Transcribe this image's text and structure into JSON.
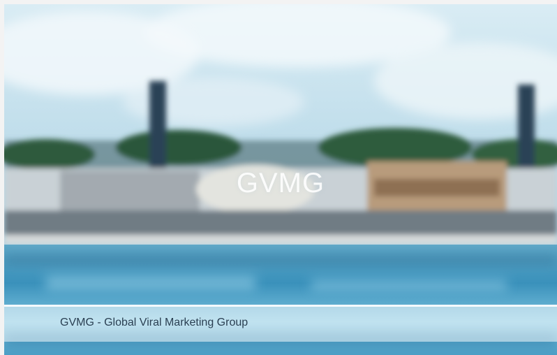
{
  "slide": {
    "title": "GVMG",
    "caption": "GVMG - Global Viral Marketing Group"
  }
}
